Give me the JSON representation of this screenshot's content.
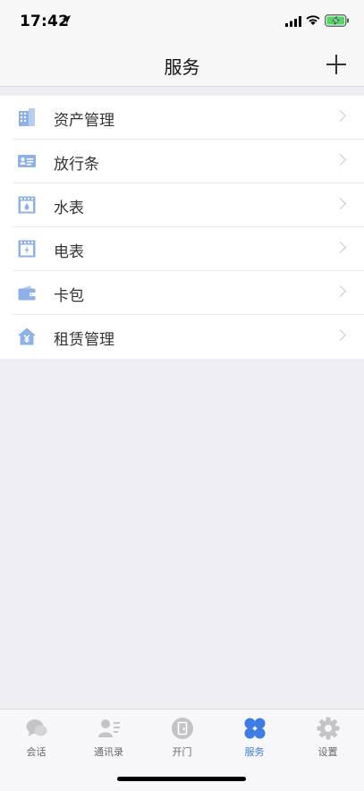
{
  "status": {
    "time": "17:42"
  },
  "nav": {
    "title": "服务"
  },
  "menu": [
    {
      "label": "资产管理",
      "icon": "building-icon"
    },
    {
      "label": "放行条",
      "icon": "id-card-icon"
    },
    {
      "label": "水表",
      "icon": "water-meter-icon"
    },
    {
      "label": "电表",
      "icon": "electric-meter-icon"
    },
    {
      "label": "卡包",
      "icon": "wallet-icon"
    },
    {
      "label": "租赁管理",
      "icon": "house-yen-icon"
    }
  ],
  "tabs": [
    {
      "label": "会话",
      "icon": "chat-icon",
      "active": false
    },
    {
      "label": "通讯录",
      "icon": "contacts-icon",
      "active": false
    },
    {
      "label": "开门",
      "icon": "door-icon",
      "active": false
    },
    {
      "label": "服务",
      "icon": "clover-icon",
      "active": true
    },
    {
      "label": "设置",
      "icon": "gear-icon",
      "active": false
    }
  ],
  "colors": {
    "accent": "#3e7de3",
    "icon_blue": "#8fb0e8",
    "inactive": "#c4c4c8",
    "background": "#eeeef3"
  }
}
